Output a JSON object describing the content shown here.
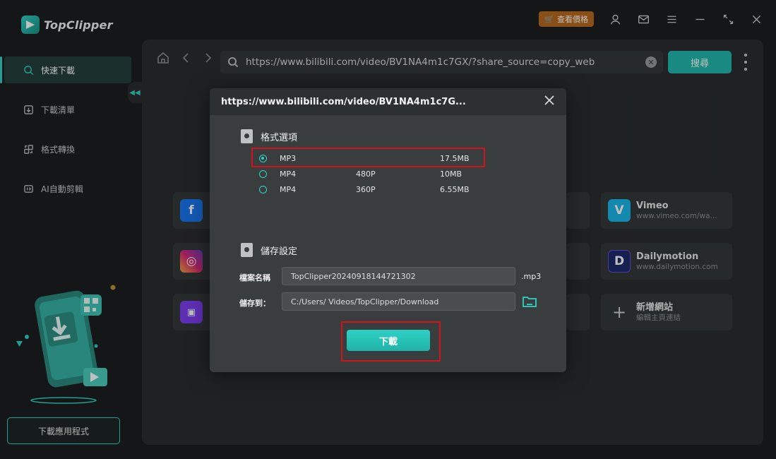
{
  "app": {
    "name": "TopClipper"
  },
  "topbar": {
    "price_label": "查看價格"
  },
  "sidebar": {
    "items": [
      {
        "label": "快速下載",
        "icon": "search-icon",
        "active": true
      },
      {
        "label": "下載清單",
        "icon": "download-list-icon",
        "active": false
      },
      {
        "label": "格式轉換",
        "icon": "convert-icon",
        "active": false
      },
      {
        "label": "AI自動剪輯",
        "icon": "ai-clip-icon",
        "active": false
      }
    ],
    "download_app_label": "下載應用程式"
  },
  "browser": {
    "url": "https://www.bilibili.com/video/BV1NA4m1c7GX/?share_source=copy_web",
    "search_label": "搜尋"
  },
  "sites": [
    {
      "name": "Vimeo",
      "url": "www.vimeo.com/wa...",
      "color": "#1ab7ea"
    },
    {
      "name": "Dailymotion",
      "url": "www.dailymotion.com",
      "color": "#1c2b6b"
    },
    {
      "name": "新增網站",
      "url": "編輯主頁連結",
      "color": "#4a4d4e"
    }
  ],
  "dialog": {
    "title": "https://www.bilibili.com/video/BV1NA4m1c7G...",
    "format_section": "格式選項",
    "formats": [
      {
        "name": "MP3",
        "resolution": "",
        "size": "17.5MB",
        "checked": true
      },
      {
        "name": "MP4",
        "resolution": "480P",
        "size": "10MB",
        "checked": false
      },
      {
        "name": "MP4",
        "resolution": "360P",
        "size": "6.55MB",
        "checked": false
      }
    ],
    "save_section": "儲存設定",
    "filename_label": "檔案名稱",
    "filename_value": "TopClipper20240918144721302",
    "extension": ".mp3",
    "saveto_label": "儲存到：",
    "saveto_value": "C:/Users/        Videos/TopClipper/Download",
    "download_label": "下載"
  },
  "colors": {
    "accent": "#2fd3c6",
    "highlight": "#d0141c",
    "price": "#b86a1f"
  }
}
